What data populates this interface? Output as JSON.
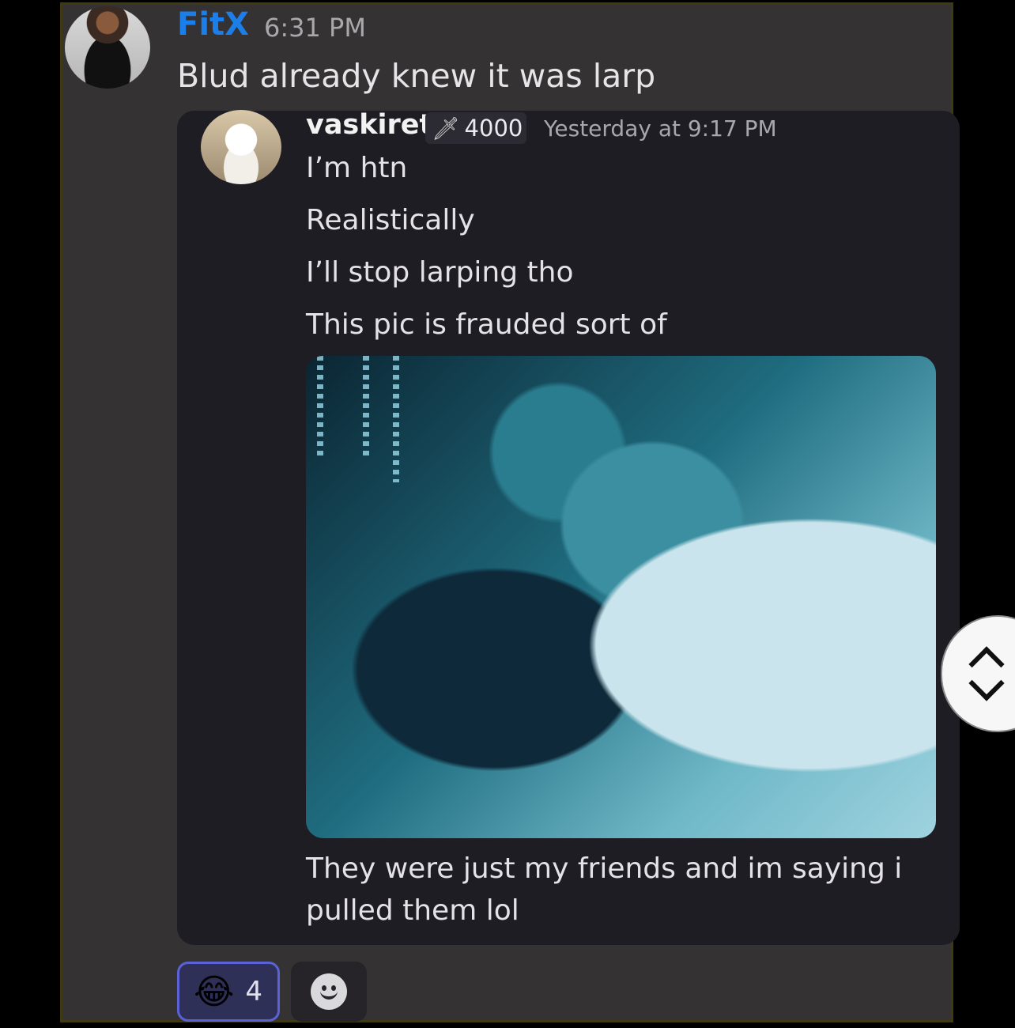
{
  "message": {
    "author": "FitX",
    "time": "6:31 PM",
    "text": "Blud already knew it was larp"
  },
  "forwarded": {
    "author": "vaskiret",
    "badge_icon": "sword-icon",
    "badge_value": "4000",
    "time": "Yesterday at 9:17 PM",
    "lines": [
      "I’m htn",
      "Realistically",
      "I’ll stop larping tho",
      "This pic is frauded sort of"
    ],
    "caption_line1": "They were just my friends and im saying i",
    "caption_line2": "pulled them lol"
  },
  "reactions": {
    "emoji": "😂",
    "count": "4",
    "add_icon": "smiley-icon"
  },
  "colors": {
    "author_link": "#1c7ee8",
    "reaction_border": "#5b62d6"
  }
}
